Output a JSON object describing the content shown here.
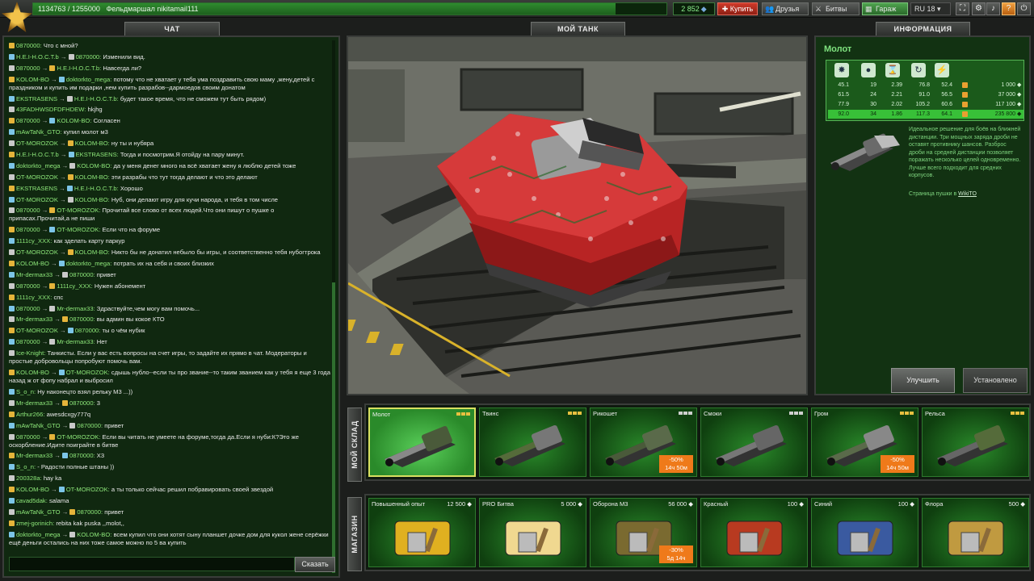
{
  "topbar": {
    "xp_text": "1134763 / 1255000",
    "rank_name": "Фельдмаршал nikitamail111",
    "crystals": "2 852",
    "buy_label": "Купить",
    "friends_label": "Друзья",
    "battles_label": "Битвы",
    "garage_label": "Гараж",
    "lang_label": "RU 18"
  },
  "chat": {
    "tab_label": "ЧАТ",
    "say_label": "Сказать",
    "messages": [
      {
        "from": "0870000:",
        "to": "",
        "text": "Что с мной?"
      },
      {
        "from": "H.E.I-H.O.C.T.b",
        "to": "0870000:",
        "text": "Изменили вид."
      },
      {
        "from": "0870000",
        "to": "H.E.I-H.O.C.T.b:",
        "text": "Навсегда ли?"
      },
      {
        "from": "KOLOM-BO",
        "to": "doktorkto_mega:",
        "text": "потому что не хватает у тебя ума поздравить свою маму ,жену,детей с праздником и купить им подарки ,нем купить разрабов--дармоедов своим донатом"
      },
      {
        "from": "EKSTRASENS",
        "to": "H.E.I-H.O.C.T.b:",
        "text": "будет такое время, что не сможем тут быть рядом)"
      },
      {
        "from": "43FADHWSDFDFHDEW:",
        "to": "",
        "text": "hkjhg"
      },
      {
        "from": "0870000",
        "to": "KOLOM-BO:",
        "text": "Согласен"
      },
      {
        "from": "mAwTaNk_GTO:",
        "to": "",
        "text": "купил молот м3"
      },
      {
        "from": "OT-MOROZOK",
        "to": "KOLOM-BO:",
        "text": "ну ты и нубяра"
      },
      {
        "from": "H.E.I-H.O.C.T.b",
        "to": "EKSTRASENS:",
        "text": "Тогда и посмотрим.Я отойду на пару минут."
      },
      {
        "from": "doktorkto_mega",
        "to": "KOLOM-BO:",
        "text": "да у меня денег много на всё хватает жену я люблю детей тоже"
      },
      {
        "from": "OT-MOROZOK",
        "to": "KOLOM-BO:",
        "text": "эти разрабы что тут тогда делают и что это делают"
      },
      {
        "from": "EKSTRASENS",
        "to": "H.E.I-H.O.C.T.b:",
        "text": "Хорошо"
      },
      {
        "from": "OT-MOROZOK",
        "to": "KOLOM-BO:",
        "text": "Нуб, они делают игру для кучи народа, и тебя в том числе"
      },
      {
        "from": "0870000",
        "to": "OT-MOROZOK:",
        "text": "Прочитай все слово от всех людей.Что они пишут о пушке о припасах.Прочитай,а не пиши"
      },
      {
        "from": "0870000",
        "to": "OT-MOROZOK:",
        "text": "Если что на форуме"
      },
      {
        "from": "1111cy_XXX:",
        "to": "",
        "text": "как зделать карту паркур"
      },
      {
        "from": "OT-MOROZOK",
        "to": "KOLOM-BO:",
        "text": "Никто бы не донатил небыло бы игры, и соответственно тебя нубогтрока"
      },
      {
        "from": "KOLOM-BO",
        "to": "doktorkto_mega:",
        "text": "потрать их на себя и своих близких"
      },
      {
        "from": "Mr-dermax33",
        "to": "0870000:",
        "text": "привет"
      },
      {
        "from": "0870000",
        "to": "1111cy_XXX:",
        "text": "Нужен абонемент"
      },
      {
        "from": "1111cy_XXX:",
        "to": "",
        "text": "спс"
      },
      {
        "from": "0870000",
        "to": "Mr-dermax33:",
        "text": "Здраствуйте,чем могу вам помочь..."
      },
      {
        "from": "Mr-dermax33",
        "to": "0870000:",
        "text": "вы админ вы кокое КТО"
      },
      {
        "from": "OT-MOROZOK",
        "to": "0870000:",
        "text": "ты о чём нубик"
      },
      {
        "from": "0870000",
        "to": "Mr-dermax33:",
        "text": "Нет"
      },
      {
        "from": "Ice-Knight:",
        "to": "",
        "text": "Танкисты. Если у вас есть вопросы на счет игры, то задайте их прямо в чат. Модераторы и простые добровольцы попробуют помочь вам."
      },
      {
        "from": "KOLOM-BO",
        "to": "OT-MOROZOK:",
        "text": "сдышь нубло--если ты про звание--то таким званием как у тебя я еще 3 года назад ж от фопу набрал и выбросил"
      },
      {
        "from": "S_o_n:",
        "to": "",
        "text": "Ну наконецто взял рельку М3 ...))"
      },
      {
        "from": "Mr-dermax33",
        "to": "0870000:",
        "text": "3"
      },
      {
        "from": "Arthur266:",
        "to": "",
        "text": "awesdcxgy777q"
      },
      {
        "from": "mAwTaNk_GTO",
        "to": "0870000:",
        "text": "привет"
      },
      {
        "from": "0870000",
        "to": "OT-MOROZOK:",
        "text": "Если вы читать не умеете на форуме,тогда да.Если я нуби:К?Это же оскорбление.Идите поиграйте в битве"
      },
      {
        "from": "Mr-dermax33",
        "to": "0870000:",
        "text": "Х3"
      },
      {
        "from": "S_o_n:",
        "to": "",
        "text": "- Радости полные штаны ))"
      },
      {
        "from": "200328a:",
        "to": "",
        "text": "hay ka"
      },
      {
        "from": "KOLOM-BO",
        "to": "OT-MOROZOK:",
        "text": "а ты только сейчас решил побравировать своей звездой"
      },
      {
        "from": "cavad5dak:",
        "to": "",
        "text": "salama"
      },
      {
        "from": "mAwTaNk_GTO",
        "to": "0870000:",
        "text": "привет"
      },
      {
        "from": "zmej-gorinich:",
        "to": "",
        "text": "rebita kak puska ,,molot,,"
      },
      {
        "from": "doktorkto_mega",
        "to": "KOLOM-BO:",
        "text": "всем купил что они хотят сыну планшет дочке дом для кукол жене серёжки ещё деньги остались на них тоже самое можно по 5 ва купить"
      }
    ]
  },
  "viewport": {
    "tab_label": "МОЙ ТАНК"
  },
  "info": {
    "tab_label": "ИНФОРМАЦИЯ",
    "item_name": "Молот",
    "stat_rows": [
      {
        "a": "45.1",
        "b": "19",
        "c": "2.39",
        "d": "76.8",
        "e": "52.4",
        "price": "1 000"
      },
      {
        "a": "61.5",
        "b": "24",
        "c": "2.21",
        "d": "91.0",
        "e": "56.5",
        "price": "37 000"
      },
      {
        "a": "77.9",
        "b": "30",
        "c": "2.02",
        "d": "105.2",
        "e": "60.6",
        "price": "117 100"
      },
      {
        "a": "92.0",
        "b": "34",
        "c": "1.86",
        "d": "117.3",
        "e": "64.1",
        "price": "235 800"
      }
    ],
    "description": "Идеальное решение для боёв на ближней дистанции. Три мощных заряда дроби не оставят противнику шансов. Разброс дроби на средней дистанции позволяет поражать несколько целей одновременно. Лучше всего подходит для средних корпусов.",
    "wiki_prefix": "Страница пушки в",
    "wiki_link": "WikiTO",
    "upgrade_label": "Улучшить",
    "installed_label": "Установлено"
  },
  "warehouse": {
    "side_label": "МОЙ СКЛАД",
    "items": [
      {
        "name": "Молот",
        "discount": "",
        "timer": ""
      },
      {
        "name": "Твинс",
        "discount": "",
        "timer": ""
      },
      {
        "name": "Рикошет",
        "discount": "-50%",
        "timer": "14ч 50м"
      },
      {
        "name": "Смоки",
        "discount": "",
        "timer": ""
      },
      {
        "name": "Гром",
        "discount": "-50%",
        "timer": "14ч 50м"
      },
      {
        "name": "Рельса",
        "discount": "",
        "timer": ""
      }
    ]
  },
  "shop": {
    "side_label": "МАГАЗИН",
    "items": [
      {
        "name": "Повышенный опыт",
        "price": "12 500",
        "discount": "",
        "timer": ""
      },
      {
        "name": "PRO Битва",
        "price": "5 000",
        "discount": "",
        "timer": ""
      },
      {
        "name": "Оборона М3",
        "price": "56 000",
        "discount": "-30%",
        "timer": "5д 14ч"
      },
      {
        "name": "Красный",
        "price": "100",
        "discount": "",
        "timer": ""
      },
      {
        "name": "Синий",
        "price": "100",
        "discount": "",
        "timer": ""
      },
      {
        "name": "Флора",
        "price": "500",
        "discount": "",
        "timer": ""
      }
    ]
  }
}
